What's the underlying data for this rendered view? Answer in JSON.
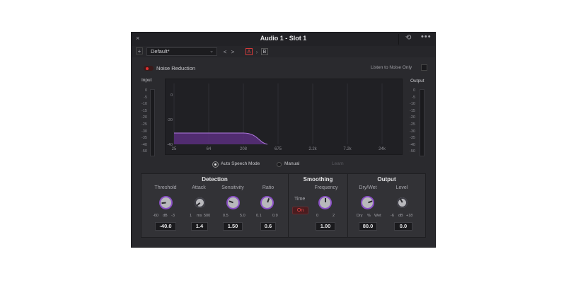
{
  "window": {
    "title": "Audio 1 - Slot 1"
  },
  "toolbar": {
    "add_label": "+",
    "preset": "Default*",
    "prev": "<",
    "next": ">",
    "ab_a": "A",
    "ab_arrow": "›",
    "ab_b": "B"
  },
  "titlebar": {
    "close": "×",
    "reset": "⟲",
    "more": "•••"
  },
  "noise_reduction": {
    "label": "Noise Reduction",
    "enabled": true
  },
  "listen": {
    "label": "Listen to Noise Only"
  },
  "meters": {
    "input_label": "Input",
    "output_label": "Output",
    "scale": [
      "0",
      "-5",
      "-10",
      "-15",
      "-20",
      "-25",
      "-30",
      "-35",
      "-40",
      "-50"
    ]
  },
  "graph": {
    "y_ticks": [
      "0",
      "-20",
      "-40"
    ],
    "x_ticks": [
      "25",
      "64",
      "208",
      "675",
      "2.2k",
      "7.2k",
      "24k"
    ]
  },
  "mode": {
    "auto": "Auto Speech Mode",
    "manual": "Manual",
    "learn": "Learn",
    "selected": "auto"
  },
  "detection": {
    "title": "Detection",
    "threshold": {
      "label": "Threshold",
      "min": "-60",
      "unit": "dB",
      "max": "-3",
      "value": "-40.0"
    },
    "attack": {
      "label": "Attack",
      "min": "1",
      "unit": "ms",
      "max": "500",
      "value": "1.4"
    },
    "sensitivity": {
      "label": "Sensitivity",
      "min": "0.5",
      "max": "5.0",
      "value": "1.50"
    },
    "ratio": {
      "label": "Ratio",
      "min": "0.1",
      "max": "0.9",
      "value": "0.6"
    }
  },
  "smoothing": {
    "title": "Smoothing",
    "time_label": "Time",
    "time_state": "On",
    "frequency": {
      "label": "Frequency",
      "min": "0",
      "max": "2",
      "value": "1.00"
    }
  },
  "output": {
    "title": "Output",
    "drywet": {
      "label": "Dry/Wet",
      "min": "Dry",
      "unit": "%",
      "max": "Wet",
      "value": "80.0"
    },
    "level": {
      "label": "Level",
      "min": "-6",
      "unit": "dB",
      "max": "+18",
      "value": "0.0"
    }
  },
  "colors": {
    "accent": "#e03030",
    "purple": "#8a4fc6",
    "panel": "#2a2a2e"
  }
}
